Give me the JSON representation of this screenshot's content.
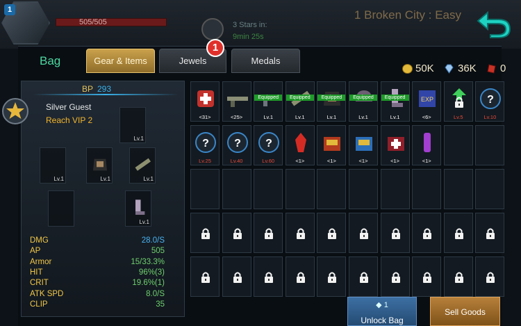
{
  "hud": {
    "player_level": "1",
    "hp_text": "505/505",
    "stars_text": "3 Stars in:",
    "timer_text": "9min 25s",
    "stage_title": "1 Broken City : Easy",
    "back_icon": "back-arrow-icon"
  },
  "bag": {
    "title": "Bag",
    "tabs": [
      {
        "label": "Gear & Items",
        "active": true
      },
      {
        "label": "Jewels",
        "active": false,
        "badge": "1"
      },
      {
        "label": "Medals",
        "active": false
      }
    ],
    "currency": {
      "gold": "50K",
      "diamonds": "36K",
      "gems": "0"
    }
  },
  "character": {
    "bp_label": "BP",
    "bp_value": "293",
    "name": "Silver Guest",
    "vip": "Reach VIP 2",
    "slots": [
      {
        "level": "Lv.1",
        "icon": "gadget-icon"
      },
      {
        "level": "Lv.1",
        "icon": "pistol-icon"
      },
      {
        "level": "Lv.1",
        "icon": "armor-icon"
      },
      {
        "level": "Lv.1",
        "icon": "rocket-launcher-icon"
      },
      {
        "level": "",
        "icon": "empty-slot-icon"
      },
      {
        "level": "Lv.1",
        "icon": "boots-icon"
      }
    ],
    "stats": [
      {
        "label": "DMG",
        "value": "28.0/S",
        "color": "#4ab2f2"
      },
      {
        "label": "AP",
        "value": "505",
        "color": "#6fd06f"
      },
      {
        "label": "Armor",
        "value": "15/33.3%",
        "color": "#6fd06f"
      },
      {
        "label": "HIT",
        "value": "96%(3)",
        "color": "#6fd06f"
      },
      {
        "label": "CRIT",
        "value": "19.6%(1)",
        "color": "#6fd06f"
      },
      {
        "label": "ATK SPD",
        "value": "8.0/S",
        "color": "#6fd06f"
      },
      {
        "label": "CLIP",
        "value": "35",
        "color": "#6fd06f"
      }
    ]
  },
  "inventory": {
    "equipped_label": "Equipped",
    "rows": [
      [
        {
          "icon": "medkit-icon",
          "sub": "<31>",
          "equipped": false
        },
        {
          "icon": "rifle-icon",
          "sub": "<25>",
          "equipped": false
        },
        {
          "icon": "gun-icon",
          "sub": "Lv.1",
          "equipped": true
        },
        {
          "icon": "rocket-launcher-icon",
          "sub": "Lv.1",
          "equipped": true
        },
        {
          "icon": "armor-icon",
          "sub": "Lv.1",
          "equipped": true
        },
        {
          "icon": "helmet-icon",
          "sub": "Lv.1",
          "equipped": true
        },
        {
          "icon": "boots-icon",
          "sub": "Lv.1",
          "equipped": true
        },
        {
          "icon": "exp-card-icon",
          "sub": "<6>",
          "equipped": false
        },
        {
          "icon": "locked-upgrade-icon",
          "sub": "Lv.5",
          "red": true,
          "equipped": false
        },
        {
          "icon": "mystery-weapon-icon",
          "sub": "Lv.10",
          "red": true,
          "equipped": false
        }
      ],
      [
        {
          "icon": "mystery-armor-icon",
          "sub": "Lv.25",
          "red": true,
          "equipped": false
        },
        {
          "icon": "mystery-gear-icon",
          "sub": "Lv.40",
          "red": true,
          "equipped": false
        },
        {
          "icon": "mystery-gun-icon",
          "sub": "Lv.60",
          "red": true,
          "equipped": false
        },
        {
          "icon": "red-crystal-icon",
          "sub": "<1>",
          "equipped": false
        },
        {
          "icon": "red-chest-icon",
          "sub": "<1>",
          "equipped": false
        },
        {
          "icon": "blue-chest-icon",
          "sub": "<1>",
          "equipped": false
        },
        {
          "icon": "medkit-chest-icon",
          "sub": "<1>",
          "equipped": false
        },
        {
          "icon": "purple-tube-icon",
          "sub": "<1>",
          "equipped": false
        },
        {
          "icon": "empty",
          "sub": "",
          "equipped": false
        },
        {
          "icon": "empty",
          "sub": "",
          "equipped": false
        }
      ]
    ],
    "empty_rows": 1,
    "locked_rows": 2,
    "lock_icon": "lock-icon"
  },
  "actions": {
    "unlock_cost": "1",
    "unlock_label": "Unlock Bag",
    "sell_label": "Sell Goods"
  }
}
